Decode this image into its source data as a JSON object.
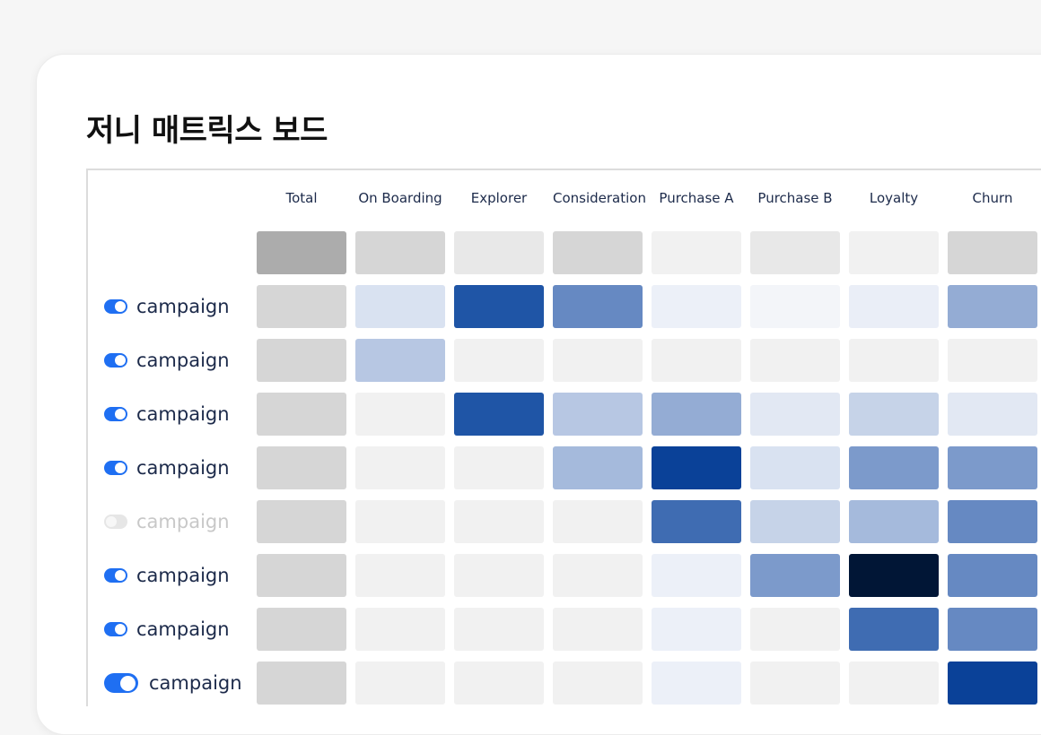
{
  "board": {
    "title": "저니 매트릭스 보드"
  },
  "columns": [
    "Total",
    "On Boarding",
    "Explorer",
    "Consideration",
    "Purchase A",
    "Purchase B",
    "Loyalty",
    "Churn"
  ],
  "summary_row": [
    "#acacac",
    "#d6d6d6",
    "#e8e8e8",
    "#d6d6d6",
    "#f1f1f1",
    "#e8e8e8",
    "#f1f1f1",
    "#d6d6d6"
  ],
  "rows": [
    {
      "label": "campaign",
      "enabled": true,
      "cells": [
        "#d6d6d6",
        "#d9e2f1",
        "#1f55a6",
        "#6689c2",
        "#ecf0f8",
        "#f3f5f9",
        "#eaeef7",
        "#94acd4"
      ]
    },
    {
      "label": "campaign",
      "enabled": true,
      "cells": [
        "#d6d6d6",
        "#b7c7e3",
        "#f1f1f1",
        "#f1f1f1",
        "#f1f1f1",
        "#f1f1f1",
        "#f1f1f1",
        "#f1f1f1"
      ]
    },
    {
      "label": "campaign",
      "enabled": true,
      "cells": [
        "#d6d6d6",
        "#f1f1f1",
        "#1f55a6",
        "#b7c7e3",
        "#94acd4",
        "#e2e8f3",
        "#c6d3e8",
        "#e2e8f3"
      ]
    },
    {
      "label": "campaign",
      "enabled": true,
      "cells": [
        "#d6d6d6",
        "#f1f1f1",
        "#f1f1f1",
        "#a5badc",
        "#0a4198",
        "#d9e2f1",
        "#7c9acb",
        "#7c9acb"
      ]
    },
    {
      "label": "campaign",
      "enabled": false,
      "cells": [
        "#d6d6d6",
        "#f1f1f1",
        "#f1f1f1",
        "#f1f1f1",
        "#3f6cb2",
        "#c6d3e8",
        "#a5badc",
        "#6689c2"
      ]
    },
    {
      "label": "campaign",
      "enabled": true,
      "cells": [
        "#d6d6d6",
        "#f1f1f1",
        "#f1f1f1",
        "#f1f1f1",
        "#ecf0f8",
        "#7c9acb",
        "#011636",
        "#6689c2"
      ]
    },
    {
      "label": "campaign",
      "enabled": true,
      "cells": [
        "#d6d6d6",
        "#f1f1f1",
        "#f1f1f1",
        "#f1f1f1",
        "#ecf0f8",
        "#f1f1f1",
        "#3f6cb2",
        "#6689c2"
      ]
    },
    {
      "label": "campaign",
      "enabled": true,
      "cells": [
        "#d6d6d6",
        "#f1f1f1",
        "#f1f1f1",
        "#f1f1f1",
        "#ecf0f8",
        "#f1f1f1",
        "#f1f1f1",
        "#0a4198"
      ]
    }
  ],
  "colors": {
    "accent": "#1f6ff2",
    "toggle_off": "#e6e6e6",
    "text_primary": "#1c2a4a"
  }
}
